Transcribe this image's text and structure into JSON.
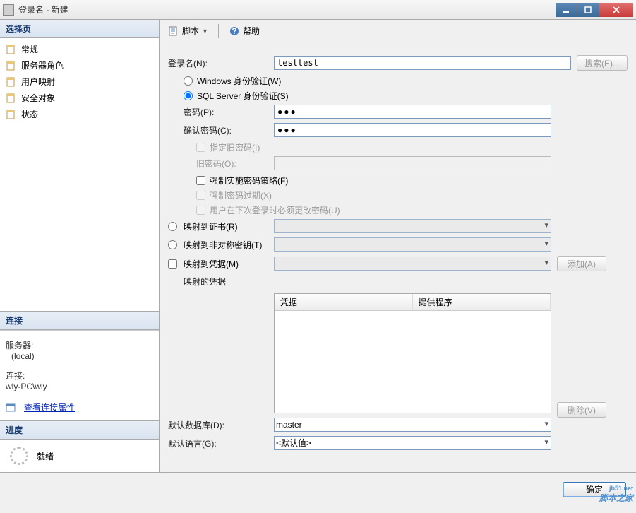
{
  "window": {
    "title": "登录名 - 新建"
  },
  "sidebar": {
    "pages_header": "选择页",
    "items": [
      {
        "label": "常规"
      },
      {
        "label": "服务器角色"
      },
      {
        "label": "用户映射"
      },
      {
        "label": "安全对象"
      },
      {
        "label": "状态"
      }
    ],
    "connection_header": "连接",
    "server_label": "服务器:",
    "server_value": "(local)",
    "conn_label": "连接:",
    "conn_value": "wly-PC\\wly",
    "view_props": "查看连接属性",
    "progress_header": "进度",
    "progress_status": "就绪"
  },
  "toolbar": {
    "script": "脚本",
    "help": "帮助"
  },
  "form": {
    "login_name_label": "登录名(N):",
    "login_name_value": "testtest",
    "search_btn": "搜索(E)...",
    "radio_windows": "Windows 身份验证(W)",
    "radio_sql": "SQL Server 身份验证(S)",
    "password_label": "密码(P):",
    "password_value": "●●●",
    "confirm_label": "确认密码(C):",
    "confirm_value": "●●●",
    "specify_old_pw": "指定旧密码(I)",
    "old_pw_label": "旧密码(O):",
    "enforce_policy": "强制实施密码策略(F)",
    "enforce_expire": "强制密码过期(X)",
    "must_change": "用户在下次登录时必须更改密码(U)",
    "map_cert": "映射到证书(R)",
    "map_asym": "映射到非对称密钥(T)",
    "map_cred": "映射到凭据(M)",
    "add_btn": "添加(A)",
    "mapped_cred_label": "映射的凭据",
    "col_cred": "凭据",
    "col_provider": "提供程序",
    "remove_btn": "删除(V)",
    "default_db_label": "默认数据库(D):",
    "default_db_value": "master",
    "default_lang_label": "默认语言(G):",
    "default_lang_value": "<默认值>"
  },
  "buttons": {
    "ok": "确定"
  },
  "watermark": {
    "text": "脚本之家",
    "url": "jb51.net"
  }
}
